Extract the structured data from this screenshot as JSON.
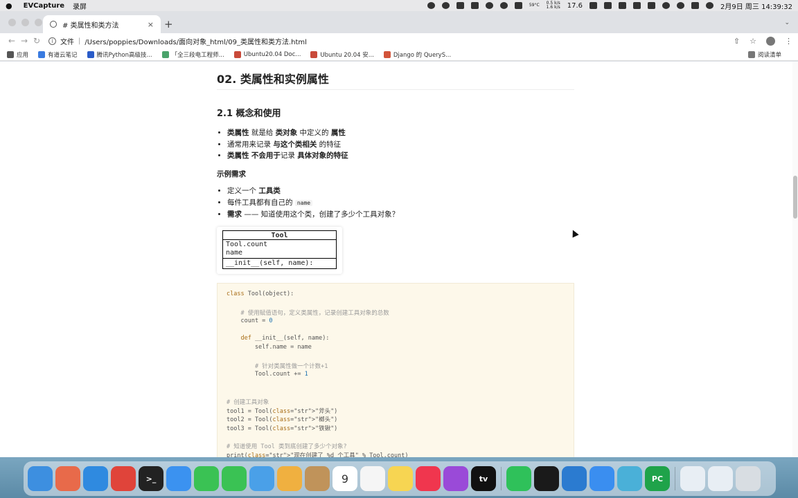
{
  "menubar": {
    "app_name": "EVCapture",
    "menu_item": "录屏",
    "cpu_temp": "59°C",
    "net_up": "0.5 k/s",
    "net_down": "1.6 k/s",
    "battery": "17.6",
    "clock": "2月9日 周三 14:39:32"
  },
  "tab": {
    "title": "# 类属性和类方法",
    "close": "×",
    "new": "+"
  },
  "toolbar": {
    "file_label": "文件",
    "url": "/Users/poppies/Downloads/面向对象_html/09_类属性和类方法.html"
  },
  "bookmarks": {
    "items": [
      {
        "label": "应用",
        "color": "#555555"
      },
      {
        "label": "有道云笔记",
        "color": "#3a7be0"
      },
      {
        "label": "腾讯Python高级技...",
        "color": "#2a5cc8"
      },
      {
        "label": "「全三段电工程师...",
        "color": "#4aa36b"
      },
      {
        "label": "Ubuntu20.04 Doc...",
        "color": "#c94a3a"
      },
      {
        "label": "Ubuntu 20.04 安...",
        "color": "#c94a3a"
      },
      {
        "label": "Django 的 QueryS...",
        "color": "#d2543a"
      }
    ],
    "reading_list": "阅读清单"
  },
  "doc": {
    "title": "02. 类属性和实例属性",
    "subtitle": "2.1 概念和使用",
    "bullets1": [
      {
        "b1": "类属性",
        "t1": " 就是给 ",
        "b2": "类对象",
        "t2": " 中定义的 ",
        "b3": "属性",
        "t3": ""
      },
      {
        "b1": "",
        "t1": "通常用来记录 ",
        "b2": "与这个类相关",
        "t2": " 的特征",
        "b3": "",
        "t3": ""
      },
      {
        "b1": "类属性",
        "t1": " ",
        "b2": "不会用于",
        "t2": "记录 ",
        "b3": "具体对象的特征",
        "t3": ""
      }
    ],
    "example_heading": "示例需求",
    "bullets2": {
      "i1_pre": "定义一个 ",
      "i1_bold": "工具类",
      "i2_pre": "每件工具都有自己的 ",
      "i2_code": "name",
      "i3_bold": "需求",
      "i3_rest": " —— 知道使用这个类，创建了多少个工具对象？"
    },
    "uml": {
      "header": "Tool",
      "attr1": "Tool.count",
      "attr2": "name",
      "method": "__init__(self, name):"
    },
    "code_lines": [
      "class Tool(object):",
      "",
      "    # 使用赋值语句，定义类属性，记录创建工具对象的总数",
      "    count = 0",
      "",
      "    def __init__(self, name):",
      "        self.name = name",
      "",
      "        # 针对类属性做一个计数+1",
      "        Tool.count += 1",
      "",
      "",
      "# 创建工具对象",
      "tool1 = Tool(\"斧头\")",
      "tool2 = Tool(\"榔头\")",
      "tool3 = Tool(\"铁锹\")",
      "",
      "# 知道使用 Tool 类到底创建了多少个对象?",
      "print(\"现在创建了 %d 个工具\" % Tool.count)"
    ]
  },
  "dock": {
    "calendar_day": "9",
    "apps": [
      {
        "name": "finder",
        "color": "#3d8fe0",
        "glyph": ""
      },
      {
        "name": "launchpad",
        "color": "#e86a4a",
        "glyph": ""
      },
      {
        "name": "safari",
        "color": "#2f8ae0",
        "glyph": ""
      },
      {
        "name": "chrome",
        "color": "#e0443a",
        "glyph": ""
      },
      {
        "name": "terminal",
        "color": "#222222",
        "glyph": ">_"
      },
      {
        "name": "mail",
        "color": "#3b92f0",
        "glyph": ""
      },
      {
        "name": "facetime",
        "color": "#3ac254",
        "glyph": ""
      },
      {
        "name": "messages",
        "color": "#3ac254",
        "glyph": ""
      },
      {
        "name": "maps",
        "color": "#4aa0e8",
        "glyph": ""
      },
      {
        "name": "photos",
        "color": "#f0b040",
        "glyph": ""
      },
      {
        "name": "contacts",
        "color": "#c0935a",
        "glyph": ""
      },
      {
        "name": "calendar",
        "color": "#ffffff",
        "glyph": "9"
      },
      {
        "name": "reminders",
        "color": "#f5f5f5",
        "glyph": ""
      },
      {
        "name": "notes",
        "color": "#f7d552",
        "glyph": ""
      },
      {
        "name": "music",
        "color": "#f0364e",
        "glyph": ""
      },
      {
        "name": "podcasts",
        "color": "#9a4ad8",
        "glyph": ""
      },
      {
        "name": "tv",
        "color": "#111111",
        "glyph": "tv"
      },
      {
        "name": "wechat",
        "color": "#2fc15a",
        "glyph": ""
      },
      {
        "name": "qq",
        "color": "#1a1a1a",
        "glyph": ""
      },
      {
        "name": "vscode",
        "color": "#2b7bd0",
        "glyph": ""
      },
      {
        "name": "baidunetdisk",
        "color": "#3a8ef0",
        "glyph": ""
      },
      {
        "name": "app-blue",
        "color": "#4ab0d8",
        "glyph": ""
      },
      {
        "name": "pycharm",
        "color": "#1fa34a",
        "glyph": "PC"
      },
      {
        "name": "screenshot1",
        "color": "#e8eef4",
        "glyph": ""
      },
      {
        "name": "screenshot2",
        "color": "#e8eef4",
        "glyph": ""
      },
      {
        "name": "trash",
        "color": "#d8dde2",
        "glyph": ""
      }
    ]
  }
}
